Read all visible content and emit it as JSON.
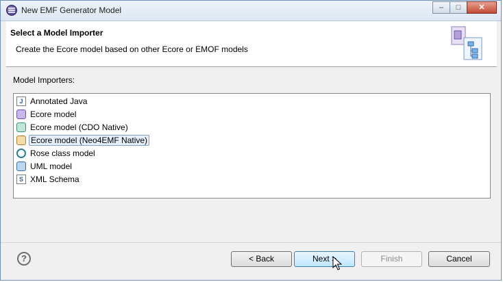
{
  "window": {
    "title": "New EMF Generator Model",
    "controls": {
      "minimize": "–",
      "maximize": "□",
      "close": "✕"
    }
  },
  "header": {
    "title": "Select a Model Importer",
    "description": "Create the Ecore model based on other Ecore or EMOF models",
    "icon": "wizard-banner-icon"
  },
  "content": {
    "label": "Model Importers:",
    "importers": [
      {
        "label": "Annotated Java",
        "icon": "java-file-icon",
        "selected": false
      },
      {
        "label": "Ecore model",
        "icon": "ecore-model-icon",
        "selected": false
      },
      {
        "label": "Ecore model (CDO Native)",
        "icon": "cdo-ecore-icon",
        "selected": false
      },
      {
        "label": "Ecore model (Neo4EMF Native)",
        "icon": "neo4emf-ecore-icon",
        "selected": true
      },
      {
        "label": "Rose class model",
        "icon": "rose-model-icon",
        "selected": false
      },
      {
        "label": "UML model",
        "icon": "uml-model-icon",
        "selected": false
      },
      {
        "label": "XML Schema",
        "icon": "xml-schema-icon",
        "selected": false
      }
    ]
  },
  "footer": {
    "help": "?",
    "back": "< Back",
    "next": "Next >",
    "finish": "Finish",
    "cancel": "Cancel"
  },
  "colors": {
    "selection_bg": "#e5eef9",
    "selection_border": "#7da2ce",
    "default_button": "#bee6fd"
  }
}
